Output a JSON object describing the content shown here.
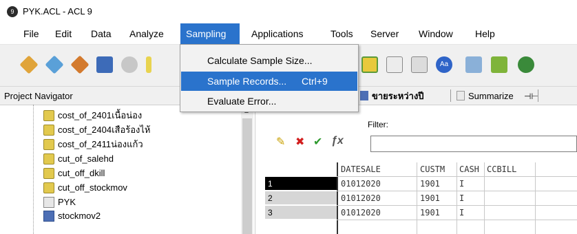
{
  "window": {
    "title": "PYK.ACL - ACL 9",
    "app_icon": "acl-logo-icon"
  },
  "menubar": {
    "items": [
      "File",
      "Edit",
      "Data",
      "Analyze",
      "Sampling",
      "Applications",
      "Tools",
      "Server",
      "Window",
      "Help"
    ],
    "active": "Sampling"
  },
  "sampling_menu": {
    "items": [
      {
        "label": "Calculate Sample Size...",
        "shortcut": ""
      },
      {
        "label": "Sample Records...",
        "shortcut": "Ctrl+9"
      },
      {
        "label": "Evaluate Error...",
        "shortcut": ""
      }
    ],
    "highlighted": 1
  },
  "project_navigator": {
    "title": "Project Navigator",
    "items": [
      {
        "label": "cost_of_2401เนื้อน่อง",
        "icon": "table-icon"
      },
      {
        "label": "cost_of_2404เสือร้องไห้",
        "icon": "table-icon"
      },
      {
        "label": "cost_of_2411น่องแก้ว",
        "icon": "table-icon"
      },
      {
        "label": "cut_of_salehd",
        "icon": "table-icon"
      },
      {
        "label": "cut_off_dkill",
        "icon": "table-icon"
      },
      {
        "label": "cut_off_stockmov",
        "icon": "table-icon"
      },
      {
        "label": "PYK",
        "icon": "script-icon"
      },
      {
        "label": "stockmov2",
        "icon": "grid-table-icon"
      }
    ]
  },
  "tabs": {
    "view_tab": "ขายระหว่างปี",
    "summarize_tab": "Summarize"
  },
  "filter": {
    "label": "Filter:",
    "value": ""
  },
  "table": {
    "columns": [
      "DATESALE",
      "CUSTM",
      "CASH",
      "CCBILL"
    ],
    "rows": [
      {
        "num": "1",
        "cells": [
          "01012020",
          "1901",
          "I",
          ""
        ]
      },
      {
        "num": "2",
        "cells": [
          "01012020",
          "1901",
          "I",
          ""
        ]
      },
      {
        "num": "3",
        "cells": [
          "01012020",
          "1901",
          "I",
          ""
        ]
      }
    ],
    "selected_row": 0
  },
  "colors": {
    "menu_highlight": "#2a73cc",
    "toolbar_bg": "#f0f0f0"
  }
}
